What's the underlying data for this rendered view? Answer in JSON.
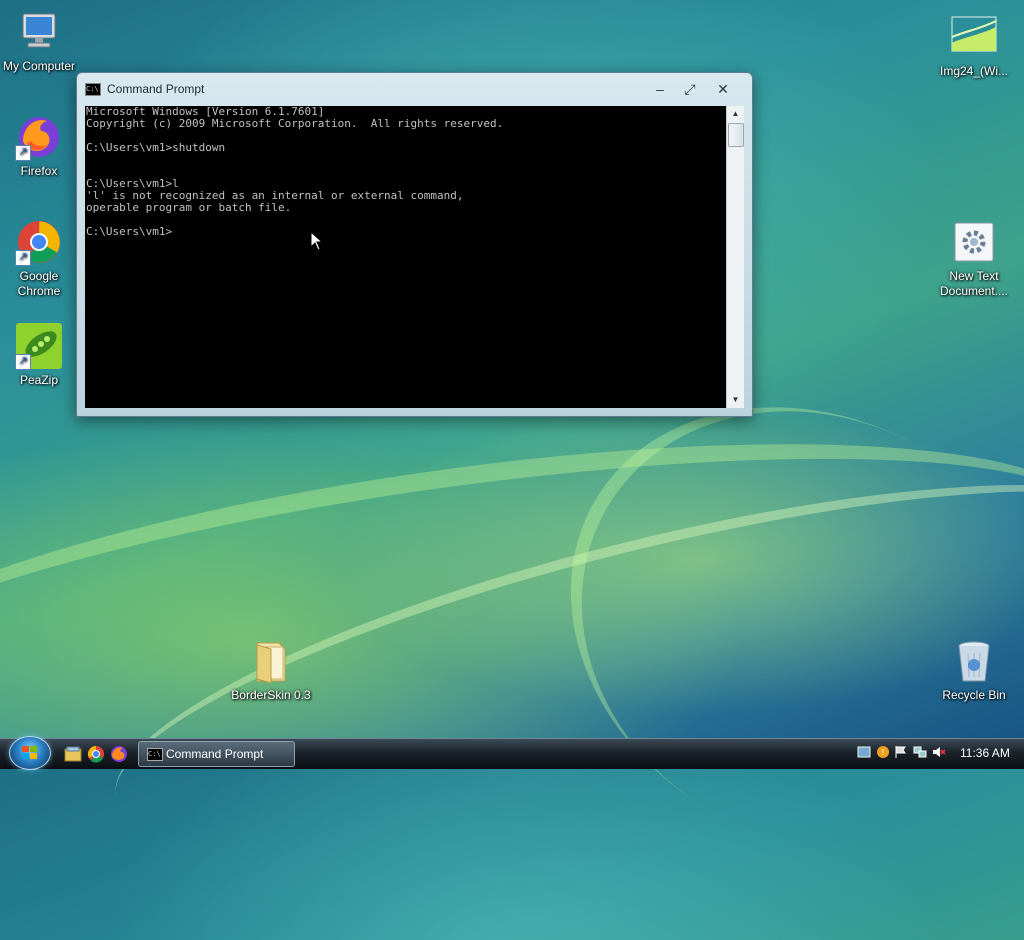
{
  "desktop": {
    "icons": [
      {
        "label": "My Computer"
      },
      {
        "label": "Firefox"
      },
      {
        "label": "Google Chrome"
      },
      {
        "label": "PeaZip"
      },
      {
        "label": "Img24_(Wi..."
      },
      {
        "label": "New Text Document...."
      },
      {
        "label": "BorderSkin 0.3"
      },
      {
        "label": "Recycle Bin"
      }
    ]
  },
  "window": {
    "title": "Command Prompt",
    "icon_text": "C:\\",
    "buttons": {
      "minimize": "–",
      "maximize": "⤢",
      "close": "✕"
    },
    "console_lines": [
      "Microsoft Windows [Version 6.1.7601]",
      "Copyright (c) 2009 Microsoft Corporation.  All rights reserved.",
      "",
      "C:\\Users\\vm1>shutdown",
      "",
      "",
      "C:\\Users\\vm1>l",
      "'l' is not recognized as an internal or external command,",
      "operable program or batch file.",
      "",
      "C:\\Users\\vm1>"
    ],
    "scroll_up": "▲",
    "scroll_down": "▼"
  },
  "taskbar": {
    "task_button_label": "Command Prompt",
    "task_icon_text": "C:\\",
    "clock": "11:36 AM"
  },
  "colors": {
    "console_bg": "#000000",
    "console_fg": "#c0c0c0"
  }
}
